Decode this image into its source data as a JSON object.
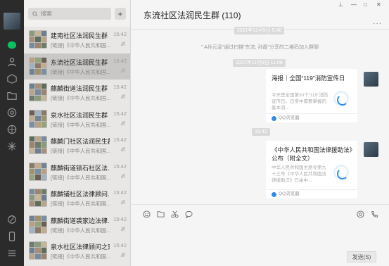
{
  "search": {
    "placeholder": "搜索"
  },
  "conversations": [
    {
      "name": "建南社区法润民生群",
      "time": "15:42",
      "preview": "[链接]《中华人民共和国...",
      "active": false
    },
    {
      "name": "东流社区法润民生群",
      "time": "15:42",
      "preview": "[链接]《中华人民共和国...",
      "active": true
    },
    {
      "name": "麒麟街道法润民生群",
      "time": "15:42",
      "preview": "[链接]《中华人民共和国...",
      "active": false
    },
    {
      "name": "泉水社区法润民生群",
      "time": "15:42",
      "preview": "[链接]《中华人民共和国...",
      "active": false
    },
    {
      "name": "麒麟门社区法润民生群",
      "time": "15:42",
      "preview": "[链接]《中华人民共和国...",
      "active": false
    },
    {
      "name": "麒麟街道锁石社区法...",
      "time": "15:42",
      "preview": "[链接]《中华人民共和国...",
      "active": false
    },
    {
      "name": "麒麟铺社区法律顾问...",
      "time": "15:42",
      "preview": "[链接]《中华人民共和国...",
      "active": false
    },
    {
      "name": "麒麟街道裘家边法律...",
      "time": "15:42",
      "preview": "[链接]《中华人民共和国...",
      "active": false
    },
    {
      "name": "泉水社区法律顾问之家",
      "time": "15:42",
      "preview": "[链接]《中华人民共和国...",
      "active": false
    }
  ],
  "chat": {
    "title": "东流社区法润民生群 (110)",
    "stamp1": "2021年11月5日 9:40",
    "system_message": "\" A孙元凌\"通过扫描\"东流, 孙磊\"分享的二维码加入群聊",
    "stamp2": "2021年11月9日 11:08",
    "stamp3": "15:42",
    "cards": [
      {
        "title": "海报｜全国“119”消防宣传日",
        "desc": "今天是全国第30个“119”消防宣传日。日常中需要掌握的基本消...",
        "source": "QQ浏览器"
      },
      {
        "title": "《中华人民共和国法律援助法》公布（附全文）",
        "desc": "中华人民共和国主席令第九十三号《中华人民共和国法律援助法》已由中...",
        "source": "QQ浏览器"
      }
    ]
  },
  "composer": {
    "send_label": "发送(S)"
  },
  "window_controls": {
    "pin": "⊥",
    "minimize": "—",
    "maximize": "□",
    "close": "✕",
    "more": "···"
  },
  "colors": {
    "rail": "#2b2b2b",
    "list_bg": "#e8e7e6",
    "active_item": "#cac8c6",
    "chat_bg": "#f5f5f5",
    "wechat_green": "#07c160"
  }
}
